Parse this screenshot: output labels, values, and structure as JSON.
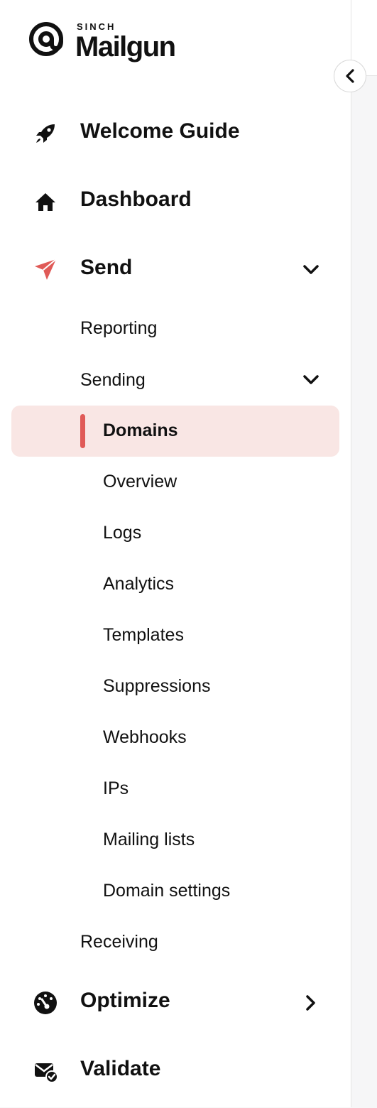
{
  "brand": {
    "small_text": "SINCH",
    "name": "Mailgun"
  },
  "sidebar": {
    "collapse_icon": "chevron-left-icon",
    "welcome_guide": {
      "label": "Welcome Guide",
      "icon": "rocket-icon"
    },
    "dashboard": {
      "label": "Dashboard",
      "icon": "home-icon"
    },
    "send": {
      "label": "Send",
      "icon": "paper-plane-icon",
      "expanded": true,
      "accent": "#e05a57"
    },
    "send_items": {
      "reporting": "Reporting",
      "sending": "Sending",
      "receiving": "Receiving"
    },
    "sending_items": {
      "domains": "Domains",
      "overview": "Overview",
      "logs": "Logs",
      "analytics": "Analytics",
      "templates": "Templates",
      "suppressions": "Suppressions",
      "webhooks": "Webhooks",
      "ips": "IPs",
      "mailing_lists": "Mailing lists",
      "domain_settings": "Domain settings"
    },
    "active_item": "Domains",
    "active_bg_color": "#f9e6e4",
    "optimize": {
      "label": "Optimize",
      "icon": "gauge-icon",
      "expanded": false
    },
    "validate": {
      "label": "Validate",
      "icon": "envelope-check-icon"
    }
  }
}
